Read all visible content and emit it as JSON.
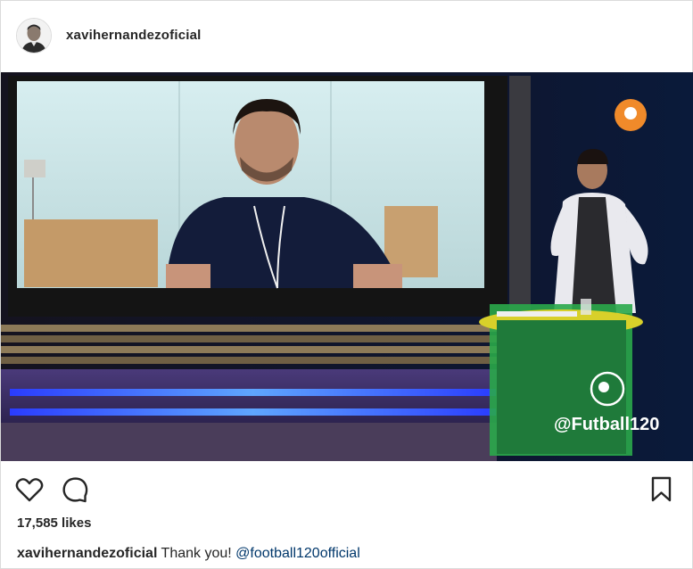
{
  "post": {
    "username": "xavihernandezoficial",
    "media_watermark": "@Futball120",
    "likes_text": "17,585 likes",
    "caption": {
      "username": "xavihernandezoficial",
      "text": "Thank you!",
      "mention": "@football120official"
    }
  },
  "icons": {
    "like": "heart-icon",
    "comment": "comment-icon",
    "save": "bookmark-icon"
  },
  "colors": {
    "mention": "#00376b",
    "border": "#dbdbdb",
    "text": "#262626"
  }
}
